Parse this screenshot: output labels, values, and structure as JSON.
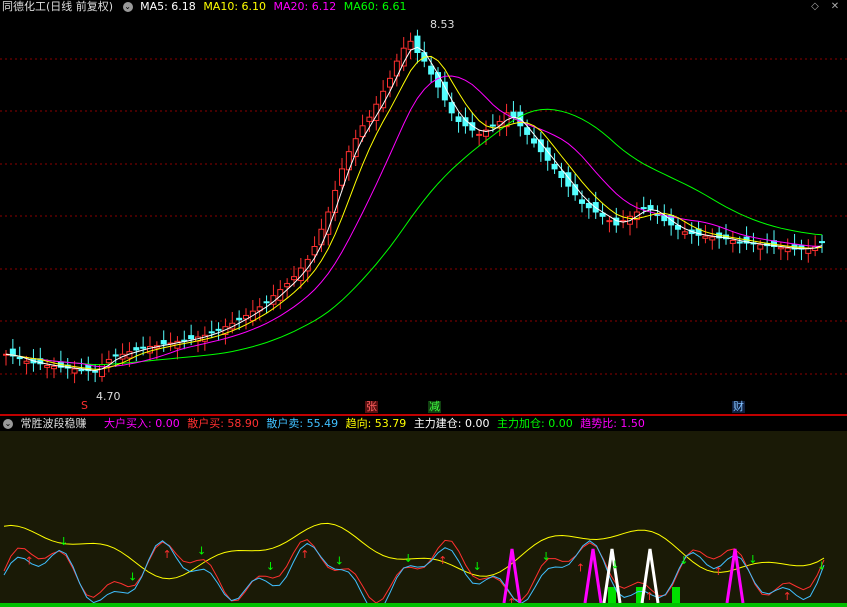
{
  "header": {
    "title": "同德化工(日线 前复权)",
    "ma": [
      {
        "label": "MA5: 6.18",
        "color": "#ffffff"
      },
      {
        "label": "MA10: 6.10",
        "color": "#ffff00"
      },
      {
        "label": "MA20: 6.12",
        "color": "#ff00ff"
      },
      {
        "label": "MA60: 6.61",
        "color": "#00ff00"
      }
    ]
  },
  "window": {
    "restore_glyph": "◇",
    "close_glyph": "✕"
  },
  "price": {
    "high_label": "8.53",
    "low_label": "4.70"
  },
  "events": [
    {
      "label": "S",
      "color": "#ff3030"
    },
    {
      "label": "张",
      "color": "#ff6060"
    },
    {
      "label": "减",
      "color": "#40ff40"
    },
    {
      "label": "财",
      "color": "#80c0ff"
    }
  ],
  "indicator": {
    "name": "常胜波段稳赚",
    "fields": [
      {
        "label": "大户买入: 0.00",
        "color": "#ff00ff"
      },
      {
        "label": "散户买: 58.90",
        "color": "#ff3030"
      },
      {
        "label": "散户卖: 55.49",
        "color": "#40c0ff"
      },
      {
        "label": "趋向: 53.79",
        "color": "#ffff00"
      },
      {
        "label": "主力建仓: 0.00",
        "color": "#ffffff"
      },
      {
        "label": "主力加仓: 0.00",
        "color": "#00ff00"
      },
      {
        "label": "趋势比: 1.50",
        "color": "#ff00ff"
      }
    ]
  },
  "colors": {
    "up": "#ff3030",
    "down": "#54ffff",
    "grid": "#8b0000",
    "ma5": "#ffffff",
    "ma10": "#ffff00",
    "ma20": "#ff00ff",
    "ma60": "#00ff00",
    "sub_bg": "#1a1a06"
  },
  "chart_data": {
    "type": "candlestick",
    "price_range_visible": [
      4.7,
      8.53
    ],
    "closes": [
      4.9,
      4.88,
      4.85,
      4.82,
      4.8,
      4.79,
      4.77,
      4.76,
      4.75,
      4.74,
      4.73,
      4.72,
      4.71,
      4.7,
      4.78,
      4.84,
      4.88,
      4.9,
      4.93,
      4.95,
      4.97,
      4.99,
      5.0,
      5.02,
      5.03,
      5.05,
      5.06,
      5.08,
      5.1,
      5.12,
      5.15,
      5.18,
      5.22,
      5.26,
      5.3,
      5.35,
      5.4,
      5.45,
      5.5,
      5.58,
      5.65,
      5.72,
      5.8,
      5.9,
      6.0,
      6.15,
      6.35,
      6.55,
      6.8,
      7.05,
      7.25,
      7.4,
      7.55,
      7.65,
      7.8,
      7.95,
      8.1,
      8.3,
      8.45,
      8.53,
      8.4,
      8.3,
      8.15,
      8.0,
      7.85,
      7.7,
      7.6,
      7.55,
      7.5,
      7.45,
      7.5,
      7.55,
      7.6,
      7.7,
      7.65,
      7.55,
      7.45,
      7.35,
      7.25,
      7.15,
      7.05,
      6.95,
      6.85,
      6.75,
      6.65,
      6.6,
      6.55,
      6.5,
      6.45,
      6.4,
      6.45,
      6.5,
      6.55,
      6.6,
      6.58,
      6.52,
      6.45,
      6.4,
      6.35,
      6.32,
      6.3,
      6.28,
      6.27,
      6.26,
      6.25,
      6.24,
      6.22,
      6.2,
      6.19,
      6.18,
      6.17,
      6.16,
      6.15,
      6.14,
      6.13,
      6.12,
      6.12,
      6.13,
      6.15,
      6.2
    ]
  }
}
